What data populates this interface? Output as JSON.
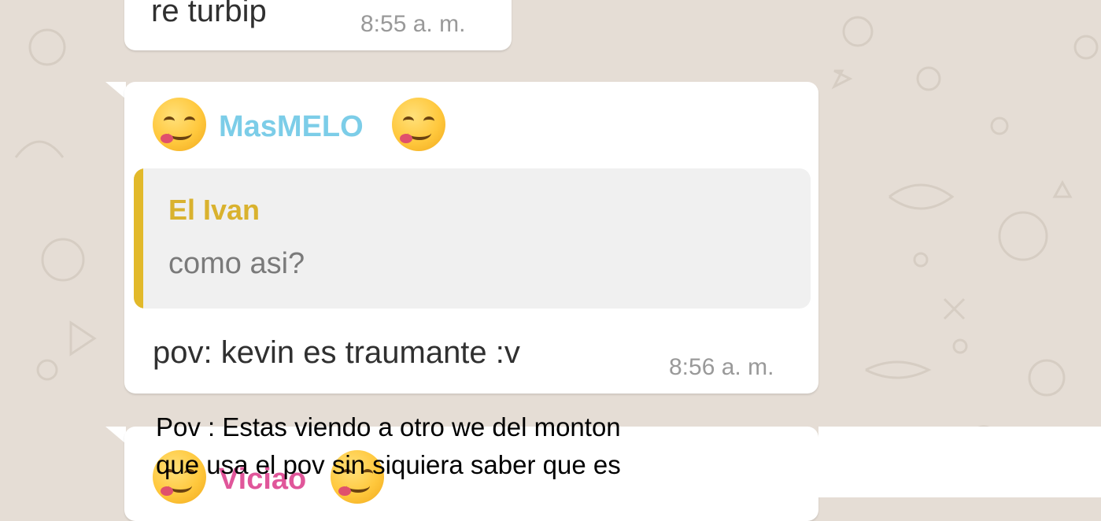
{
  "chat": {
    "messages": [
      {
        "text": "re turbip",
        "time": "8:55 a. m."
      },
      {
        "sender": "MasMELO",
        "sender_color": "#7ccde8",
        "sender_emoji": "smiling-face-savoring-food-icon",
        "quoted": {
          "name": "El Ivan",
          "name_color": "#d9b22e",
          "text": "como asi?"
        },
        "text": "pov: kevin es traumante :v",
        "time": "8:56 a. m."
      },
      {
        "sender": "Viciao",
        "sender_color": "#e0569a"
      }
    ]
  },
  "caption": {
    "line1": "Pov : Estas viendo a otro we del monton",
    "line2": "que usa el pov sin siquiera saber que es"
  },
  "colors": {
    "chat_background": "#e5ddd5",
    "bubble": "#ffffff",
    "quote_bar": "#e2b92a"
  }
}
